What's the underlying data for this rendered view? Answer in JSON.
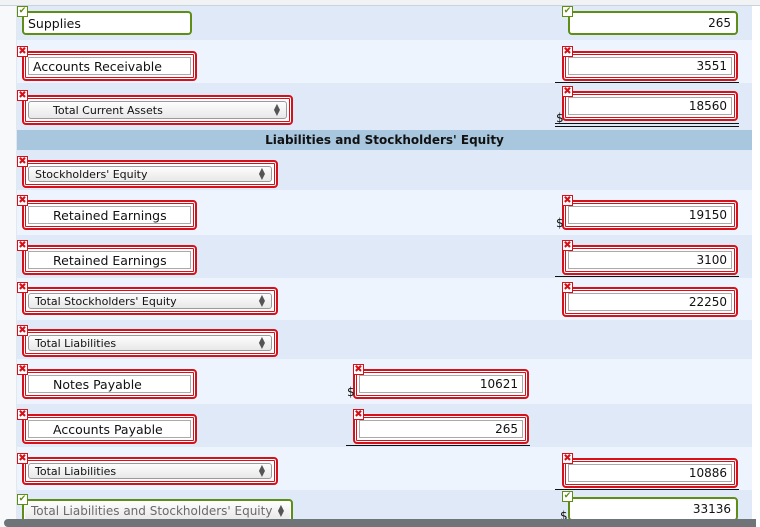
{
  "section_header": "Liabilities and Stockholders' Equity",
  "rows": [
    {
      "label": "Supplies",
      "label_status": "correct",
      "label_type": "text",
      "amount": "265",
      "amount_status": "correct",
      "amount_col": "right",
      "dollar": false
    },
    {
      "label": "Accounts Receivable",
      "label_status": "incorrect",
      "label_type": "text",
      "amount": "3551",
      "amount_status": "incorrect",
      "amount_col": "right",
      "dollar": false
    },
    {
      "label": "Total Current Assets",
      "label_status": "incorrect",
      "label_type": "select",
      "amount": "18560",
      "amount_status": "incorrect",
      "amount_col": "right",
      "dollar": true
    },
    {
      "label": "Stockholders' Equity",
      "label_status": "incorrect",
      "label_type": "select"
    },
    {
      "label": "Retained Earnings",
      "label_status": "incorrect",
      "label_type": "text",
      "amount": "19150",
      "amount_status": "incorrect",
      "amount_col": "right",
      "dollar": true
    },
    {
      "label": "Retained Earnings",
      "label_status": "incorrect",
      "label_type": "text",
      "amount": "3100",
      "amount_status": "incorrect",
      "amount_col": "right",
      "dollar": false
    },
    {
      "label": "Total Stockholders' Equity",
      "label_status": "incorrect",
      "label_type": "select",
      "amount": "22250",
      "amount_status": "incorrect",
      "amount_col": "right",
      "dollar": false
    },
    {
      "label": "Total Liabilities",
      "label_status": "incorrect",
      "label_type": "select"
    },
    {
      "label": "Notes Payable",
      "label_status": "incorrect",
      "label_type": "text",
      "amount": "10621",
      "amount_status": "incorrect",
      "amount_col": "middle",
      "dollar": true
    },
    {
      "label": "Accounts Payable",
      "label_status": "incorrect",
      "label_type": "text",
      "amount": "265",
      "amount_status": "incorrect",
      "amount_col": "middle",
      "dollar": false
    },
    {
      "label": "Total Liabilities",
      "label_status": "incorrect",
      "label_type": "select",
      "amount": "10886",
      "amount_status": "incorrect",
      "amount_col": "right",
      "dollar": false
    },
    {
      "label": "Total Liabilities and Stockholders' Equity",
      "label_status": "correct",
      "label_type": "select",
      "amount": "33136",
      "amount_status": "correct",
      "amount_col": "right",
      "dollar": true
    }
  ],
  "symbols": {
    "dollar": "$",
    "incorrect": "✖",
    "correct": "✔",
    "select_arrow_up": "▲",
    "select_arrow_down": "▼"
  },
  "colors": {
    "incorrect": "#d4121c",
    "correct": "#5e8e16",
    "row_dark": "#dfe9f8",
    "row_light": "#edf4fe",
    "header": "#a9c6df"
  }
}
